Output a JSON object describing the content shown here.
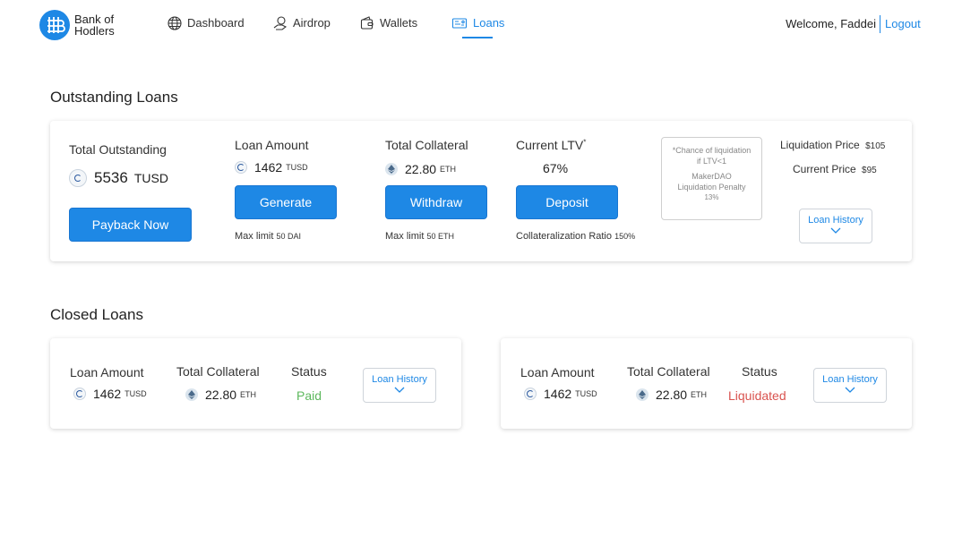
{
  "brand": {
    "name_line1": "Bank of",
    "name_line2": "Hodlers"
  },
  "nav": [
    {
      "label": "Dashboard",
      "icon": "globe-icon"
    },
    {
      "label": "Airdrop",
      "icon": "airdrop-icon"
    },
    {
      "label": "Wallets",
      "icon": "wallet-icon"
    },
    {
      "label": "Loans",
      "icon": "loans-icon",
      "active": true
    }
  ],
  "user": {
    "welcome": "Welcome, Faddei",
    "logout": "Logout"
  },
  "colors": {
    "accent": "#1e88e5",
    "paid": "#5cb85c",
    "liquidated": "#d9534f"
  },
  "outstanding": {
    "section_title": "Outstanding Loans",
    "total_label": "Total Outstanding",
    "total_value": "5536",
    "total_unit": "TUSD",
    "payback_button": "Payback Now",
    "loan_amount_label": "Loan Amount",
    "loan_amount_value": "1462",
    "loan_amount_unit": "TUSD",
    "generate_button": "Generate",
    "max_limit_dai_prefix": "Max limit",
    "max_limit_dai_value": "50 DAI",
    "collateral_label": "Total Collateral",
    "collateral_value": "22.80",
    "collateral_unit": "ETH",
    "withdraw_button": "Withdraw",
    "max_limit_eth_prefix": "Max limit",
    "max_limit_eth_value": "50 ETH",
    "ltv_label": "Current LTV",
    "ltv_asterisk": "*",
    "ltv_value": "67%",
    "deposit_button": "Deposit",
    "collat_ratio_label": "Collateralization Ratio",
    "collat_ratio_value": "150%",
    "info_line1": "*Chance of liquidation",
    "info_line2": "if LTV<1",
    "info_line3": "MakerDAO",
    "info_line4": "Liquidation Penalty",
    "info_line5": "13%",
    "liq_price_label": "Liquidation Price",
    "liq_price_value": "$105",
    "current_price_label": "Current Price",
    "current_price_value": "$95",
    "history_button": "Loan History"
  },
  "closed": {
    "section_title": "Closed Loans",
    "loans": [
      {
        "loan_amount_label": "Loan Amount",
        "loan_amount_value": "1462",
        "loan_amount_unit": "TUSD",
        "collateral_label": "Total Collateral",
        "collateral_value": "22.80",
        "collateral_unit": "ETH",
        "status_label": "Status",
        "status_value": "Paid",
        "history_button": "Loan History"
      },
      {
        "loan_amount_label": "Loan Amount",
        "loan_amount_value": "1462",
        "loan_amount_unit": "TUSD",
        "collateral_label": "Total Collateral",
        "collateral_value": "22.80",
        "collateral_unit": "ETH",
        "status_label": "Status",
        "status_value": "Liquidated",
        "history_button": "Loan History"
      }
    ]
  }
}
